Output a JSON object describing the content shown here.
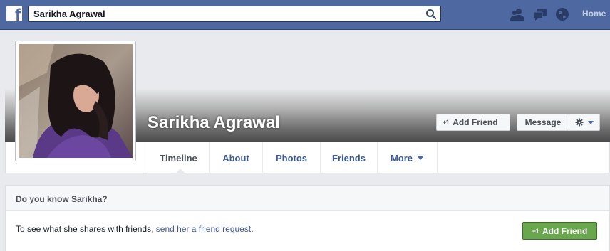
{
  "topbar": {
    "search_value": "Sarikha Agrawal",
    "home_label": "Home",
    "bar_color": "#4e69a2"
  },
  "profile": {
    "name": "Sarikha Agrawal",
    "add_friend_label": "Add Friend",
    "add_friend_badge": "+1",
    "message_label": "Message",
    "tabs": [
      {
        "label": "Timeline",
        "active": true
      },
      {
        "label": "About"
      },
      {
        "label": "Photos"
      },
      {
        "label": "Friends"
      },
      {
        "label": "More"
      }
    ]
  },
  "know_box": {
    "title": "Do you know Sarikha?",
    "text": "To see what she shares with friends, ",
    "link": "send her a friend request",
    "text_end": ".",
    "button_label": "Add Friend",
    "button_badge": "+1",
    "button_color": "#69a74e"
  },
  "icons": {
    "logo": "facebook-logo",
    "search": "search-icon",
    "friends": "friend-requests-icon",
    "messages": "messages-icon",
    "notifications": "globe-notifications-icon",
    "gear": "gear-icon"
  }
}
